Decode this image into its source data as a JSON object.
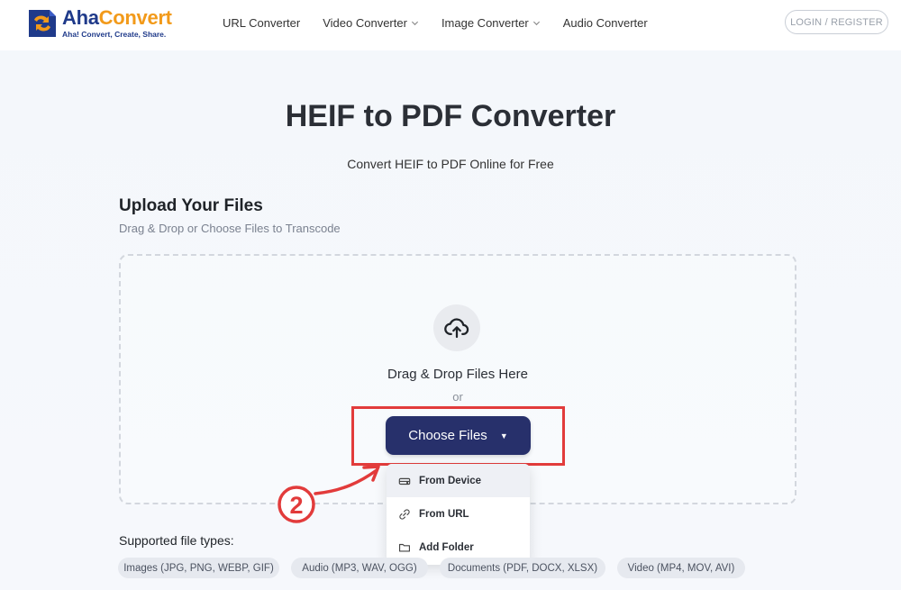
{
  "brand": {
    "name_part1": "Aha",
    "name_part2": "Convert",
    "tagline": "Aha! Convert, Create, Share."
  },
  "nav": {
    "items": [
      {
        "label": "URL Converter",
        "has_dropdown": false
      },
      {
        "label": "Video Converter",
        "has_dropdown": true
      },
      {
        "label": "Image Converter",
        "has_dropdown": true
      },
      {
        "label": "Audio Converter",
        "has_dropdown": false
      }
    ],
    "login_label": "LOGIN / REGISTER"
  },
  "hero": {
    "title": "HEIF to PDF Converter",
    "subtitle": "Convert HEIF to PDF Online for Free"
  },
  "upload": {
    "title": "Upload Your Files",
    "subtitle": "Drag & Drop or Choose Files to Transcode",
    "drop_text": "Drag & Drop Files Here",
    "or_text": "or",
    "choose_label": "Choose Files",
    "choose_caret": "▼",
    "dropdown": [
      {
        "label": "From Device",
        "icon": "hard-drive-icon"
      },
      {
        "label": "From URL",
        "icon": "link-icon"
      },
      {
        "label": "Add Folder",
        "icon": "folder-icon"
      }
    ]
  },
  "supported": {
    "label": "Supported file types:",
    "chips": [
      "Images (JPG, PNG, WEBP, GIF)",
      "Audio (MP3, WAV, OGG)",
      "Documents (PDF, DOCX, XLSX)",
      "Video (MP4, MOV, AVI)"
    ]
  },
  "annotation": {
    "step_number": "2",
    "color": "#e23b3b"
  },
  "colors": {
    "brand_blue": "#1f3a8a",
    "brand_orange": "#f29a1a",
    "button_navy": "#27306b",
    "highlight_red": "#e23b3b"
  }
}
